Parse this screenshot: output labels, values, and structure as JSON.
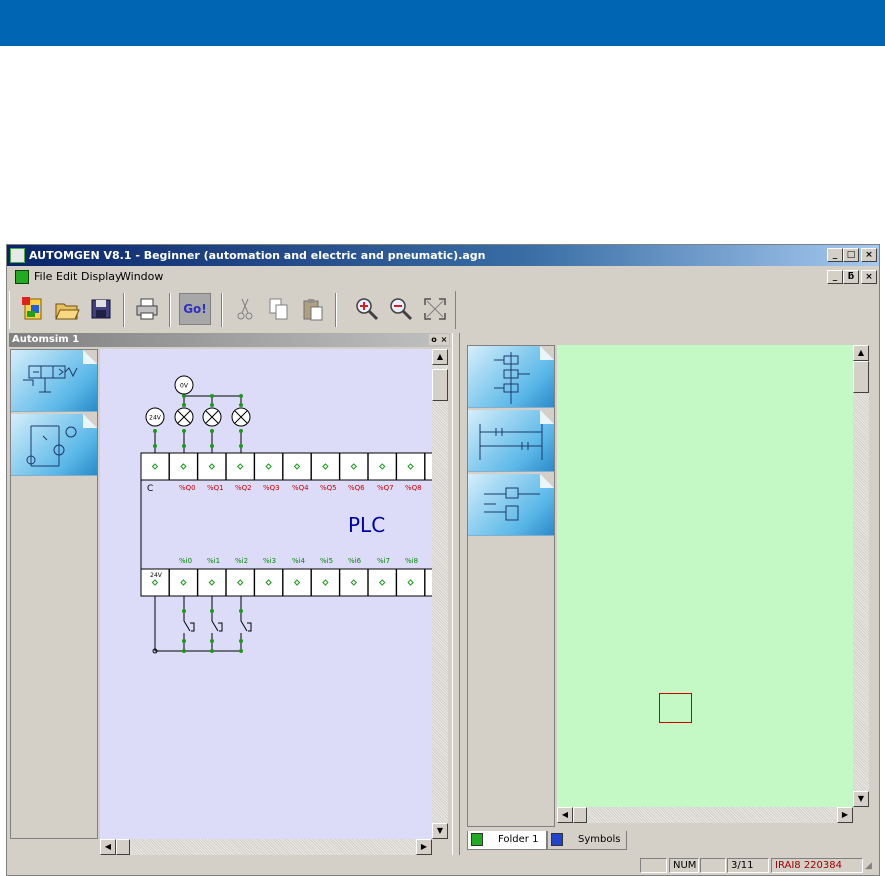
{
  "window": {
    "title": "AUTOMGEN V8.1 - Beginner (automation and electric and pneumatic).agn",
    "caption_min": "_",
    "caption_max": "□",
    "caption_close": "×",
    "mdi_restore": "ƃ"
  },
  "menu": {
    "items": [
      "File",
      "Edit",
      "Display",
      "Window"
    ]
  },
  "toolbar": {
    "go_label": "Go!",
    "buttons": [
      "new-project",
      "open",
      "save",
      "print",
      "go",
      "cut",
      "copy",
      "paste",
      "zoom-in",
      "zoom-out",
      "fit"
    ]
  },
  "left_pane": {
    "caption": "Automsim 1",
    "plc_label": "PLC",
    "common_label": "C",
    "supply_0v": "0V",
    "supply_24v_top": "24V",
    "supply_24v_bottom": "24V",
    "outputs": [
      "%Q0",
      "%Q1",
      "%Q2",
      "%Q3",
      "%Q4",
      "%Q5",
      "%Q6",
      "%Q7",
      "%Q8"
    ],
    "inputs": [
      "%i0",
      "%i1",
      "%i2",
      "%i3",
      "%i4",
      "%i5",
      "%i6",
      "%i7",
      "%i8"
    ]
  },
  "right_pane": {
    "tabs": [
      "Folder 1",
      "Symbols"
    ]
  },
  "statusbar": {
    "num": "NUM",
    "position": "3/11",
    "code": "IRAI8 220384"
  },
  "colors": {
    "header_band": "#0066b3",
    "sim_bg": "#dcdcf8",
    "editor_bg": "#c4f8c4",
    "output_label": "#cc0000",
    "input_label": "#008800",
    "plc_text": "#0000aa"
  }
}
